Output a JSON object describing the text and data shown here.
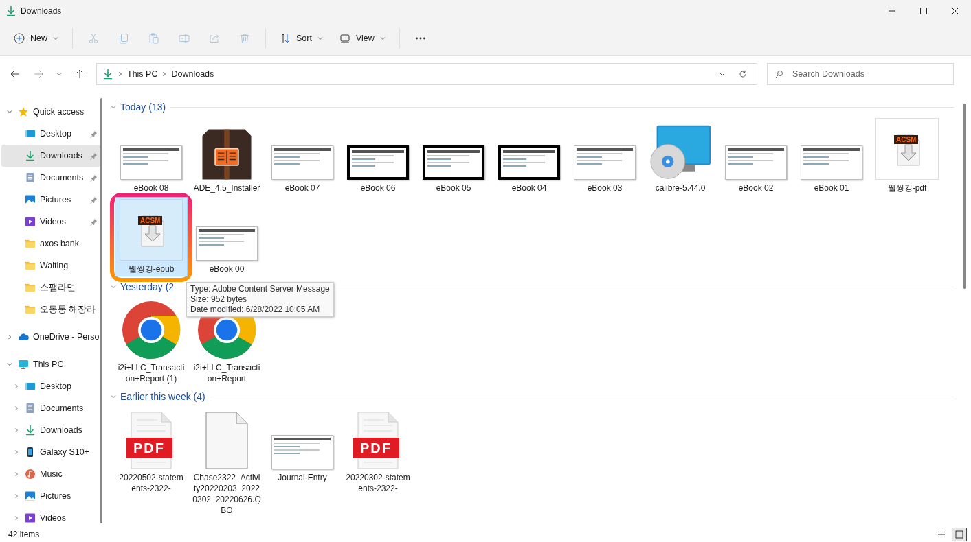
{
  "window": {
    "title": "Downloads"
  },
  "toolbar": [
    [
      {
        "kind": "new",
        "label": "New",
        "disabled": false
      }
    ],
    [
      {
        "kind": "cut",
        "disabled": true
      },
      {
        "kind": "copy",
        "disabled": true
      },
      {
        "kind": "paste",
        "disabled": true
      },
      {
        "kind": "rename",
        "disabled": true
      },
      {
        "kind": "share",
        "disabled": true
      },
      {
        "kind": "delete",
        "disabled": true
      }
    ],
    [
      {
        "kind": "sort",
        "label": "Sort",
        "disabled": false
      },
      {
        "kind": "view",
        "label": "View",
        "disabled": false
      }
    ],
    [
      {
        "kind": "more",
        "disabled": false
      }
    ]
  ],
  "navigation": {
    "back_disabled": false,
    "forward_disabled": true
  },
  "address": {
    "path": [
      "This PC",
      "Downloads"
    ]
  },
  "search": {
    "placeholder": "Search Downloads"
  },
  "sidebar": {
    "items": [
      {
        "label": "Quick access",
        "kind": "star",
        "expanded": true,
        "selected": false,
        "children": [
          {
            "label": "Desktop",
            "kind": "desktop",
            "pinned": true,
            "selected": false
          },
          {
            "label": "Downloads",
            "kind": "download",
            "pinned": true,
            "selected": true
          },
          {
            "label": "Documents",
            "kind": "documents",
            "pinned": true,
            "selected": false
          },
          {
            "label": "Pictures",
            "kind": "pictures",
            "pinned": true,
            "selected": false
          },
          {
            "label": "Videos",
            "kind": "videos",
            "pinned": true,
            "selected": false
          },
          {
            "label": "axos bank",
            "kind": "folder",
            "pinned": false,
            "selected": false
          },
          {
            "label": "Waiting",
            "kind": "folder",
            "pinned": false,
            "selected": false
          },
          {
            "label": "스팸라면",
            "kind": "folder",
            "pinned": false,
            "selected": false
          },
          {
            "label": "오동통 해장라",
            "kind": "folder",
            "pinned": false,
            "selected": false
          }
        ]
      },
      {
        "label": "OneDrive - Perso",
        "kind": "cloud",
        "expanded": false,
        "selected": false
      },
      {
        "label": "This PC",
        "kind": "pc",
        "expanded": true,
        "selected": false,
        "children": [
          {
            "label": "Desktop",
            "kind": "desktop",
            "expanded": false,
            "selected": false
          },
          {
            "label": "Documents",
            "kind": "documents",
            "expanded": false,
            "selected": false
          },
          {
            "label": "Downloads",
            "kind": "download",
            "expanded": false,
            "selected": false
          },
          {
            "label": "Galaxy S10+",
            "kind": "phone",
            "expanded": false,
            "selected": false
          },
          {
            "label": "Music",
            "kind": "music",
            "expanded": false,
            "selected": false
          },
          {
            "label": "Pictures",
            "kind": "pictures",
            "expanded": false,
            "selected": false
          },
          {
            "label": "Videos",
            "kind": "videos",
            "expanded": false,
            "selected": false
          }
        ]
      }
    ]
  },
  "sections": [
    {
      "title": "Today (13)",
      "expanded": true,
      "items": [
        {
          "name": "eBook 08",
          "kind": "screenshot",
          "dark_frame": false,
          "selected": false,
          "highlighted": false
        },
        {
          "name": "ADE_4.5_Installer",
          "kind": "package",
          "selected": false,
          "highlighted": false
        },
        {
          "name": "eBook 07",
          "kind": "screenshot",
          "dark_frame": false,
          "selected": false,
          "highlighted": false
        },
        {
          "name": "eBook 06",
          "kind": "screenshot",
          "dark_frame": true,
          "selected": false,
          "highlighted": false
        },
        {
          "name": "eBook 05",
          "kind": "screenshot",
          "dark_frame": true,
          "selected": false,
          "highlighted": false
        },
        {
          "name": "eBook 04",
          "kind": "screenshot",
          "dark_frame": true,
          "selected": false,
          "highlighted": false
        },
        {
          "name": "eBook 03",
          "kind": "screenshot",
          "dark_frame": false,
          "selected": false,
          "highlighted": false
        },
        {
          "name": "calibre-5.44.0",
          "kind": "installer",
          "selected": false,
          "highlighted": false
        },
        {
          "name": "eBook 02",
          "kind": "screenshot",
          "dark_frame": false,
          "selected": false,
          "highlighted": false
        },
        {
          "name": "eBook 01",
          "kind": "screenshot",
          "dark_frame": false,
          "selected": false,
          "highlighted": false
        },
        {
          "name": "웰씽킹-pdf",
          "kind": "acsm",
          "badge": "ACSM",
          "selected": false,
          "highlighted": false
        },
        {
          "name": "웰씽킹-epub",
          "kind": "acsm",
          "badge": "ACSM",
          "selected": true,
          "highlighted": true
        },
        {
          "name": "eBook 00",
          "kind": "screenshot",
          "dark_frame": false,
          "selected": false,
          "highlighted": false
        }
      ]
    },
    {
      "title": "Yesterday (2",
      "expanded": true,
      "items": [
        {
          "name": "i2i+LLC_Transaction+Report (1)",
          "kind": "chrome",
          "selected": false,
          "highlighted": false
        },
        {
          "name": "i2i+LLC_Transaction+Report",
          "kind": "chrome",
          "selected": false,
          "highlighted": false
        }
      ]
    },
    {
      "title": "Earlier this week (4)",
      "expanded": true,
      "items": [
        {
          "name": "20220502-statements-2322-",
          "kind": "pdf",
          "badge": "PDF",
          "selected": false,
          "highlighted": false
        },
        {
          "name": "Chase2322_Activity20220203_20220302_20220626.QBO",
          "kind": "blank",
          "selected": false,
          "highlighted": false
        },
        {
          "name": "Journal-Entry",
          "kind": "screenshot",
          "dark_frame": false,
          "selected": false,
          "highlighted": false
        },
        {
          "name": "20220302-statements-2322-",
          "kind": "pdf",
          "badge": "PDF",
          "selected": false,
          "highlighted": false
        }
      ]
    }
  ],
  "tooltip": {
    "lines": [
      "Type: Adobe Content Server Message",
      "Size: 952 bytes",
      "Date modified: 6/28/2022 10:05 AM"
    ]
  },
  "status_bar": {
    "count": "42 items",
    "view_modes": [
      {
        "kind": "details",
        "selected": false
      },
      {
        "kind": "large-icons",
        "selected": true
      }
    ]
  }
}
